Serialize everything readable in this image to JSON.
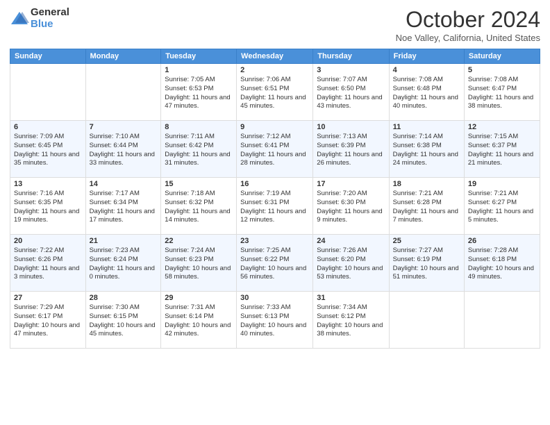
{
  "logo": {
    "general": "General",
    "blue": "Blue"
  },
  "title": "October 2024",
  "location": "Noe Valley, California, United States",
  "days_of_week": [
    "Sunday",
    "Monday",
    "Tuesday",
    "Wednesday",
    "Thursday",
    "Friday",
    "Saturday"
  ],
  "weeks": [
    [
      {
        "day": "",
        "info": ""
      },
      {
        "day": "",
        "info": ""
      },
      {
        "day": "1",
        "info": "Sunrise: 7:05 AM\nSunset: 6:53 PM\nDaylight: 11 hours and 47 minutes."
      },
      {
        "day": "2",
        "info": "Sunrise: 7:06 AM\nSunset: 6:51 PM\nDaylight: 11 hours and 45 minutes."
      },
      {
        "day": "3",
        "info": "Sunrise: 7:07 AM\nSunset: 6:50 PM\nDaylight: 11 hours and 43 minutes."
      },
      {
        "day": "4",
        "info": "Sunrise: 7:08 AM\nSunset: 6:48 PM\nDaylight: 11 hours and 40 minutes."
      },
      {
        "day": "5",
        "info": "Sunrise: 7:08 AM\nSunset: 6:47 PM\nDaylight: 11 hours and 38 minutes."
      }
    ],
    [
      {
        "day": "6",
        "info": "Sunrise: 7:09 AM\nSunset: 6:45 PM\nDaylight: 11 hours and 35 minutes."
      },
      {
        "day": "7",
        "info": "Sunrise: 7:10 AM\nSunset: 6:44 PM\nDaylight: 11 hours and 33 minutes."
      },
      {
        "day": "8",
        "info": "Sunrise: 7:11 AM\nSunset: 6:42 PM\nDaylight: 11 hours and 31 minutes."
      },
      {
        "day": "9",
        "info": "Sunrise: 7:12 AM\nSunset: 6:41 PM\nDaylight: 11 hours and 28 minutes."
      },
      {
        "day": "10",
        "info": "Sunrise: 7:13 AM\nSunset: 6:39 PM\nDaylight: 11 hours and 26 minutes."
      },
      {
        "day": "11",
        "info": "Sunrise: 7:14 AM\nSunset: 6:38 PM\nDaylight: 11 hours and 24 minutes."
      },
      {
        "day": "12",
        "info": "Sunrise: 7:15 AM\nSunset: 6:37 PM\nDaylight: 11 hours and 21 minutes."
      }
    ],
    [
      {
        "day": "13",
        "info": "Sunrise: 7:16 AM\nSunset: 6:35 PM\nDaylight: 11 hours and 19 minutes."
      },
      {
        "day": "14",
        "info": "Sunrise: 7:17 AM\nSunset: 6:34 PM\nDaylight: 11 hours and 17 minutes."
      },
      {
        "day": "15",
        "info": "Sunrise: 7:18 AM\nSunset: 6:32 PM\nDaylight: 11 hours and 14 minutes."
      },
      {
        "day": "16",
        "info": "Sunrise: 7:19 AM\nSunset: 6:31 PM\nDaylight: 11 hours and 12 minutes."
      },
      {
        "day": "17",
        "info": "Sunrise: 7:20 AM\nSunset: 6:30 PM\nDaylight: 11 hours and 9 minutes."
      },
      {
        "day": "18",
        "info": "Sunrise: 7:21 AM\nSunset: 6:28 PM\nDaylight: 11 hours and 7 minutes."
      },
      {
        "day": "19",
        "info": "Sunrise: 7:21 AM\nSunset: 6:27 PM\nDaylight: 11 hours and 5 minutes."
      }
    ],
    [
      {
        "day": "20",
        "info": "Sunrise: 7:22 AM\nSunset: 6:26 PM\nDaylight: 11 hours and 3 minutes."
      },
      {
        "day": "21",
        "info": "Sunrise: 7:23 AM\nSunset: 6:24 PM\nDaylight: 11 hours and 0 minutes."
      },
      {
        "day": "22",
        "info": "Sunrise: 7:24 AM\nSunset: 6:23 PM\nDaylight: 10 hours and 58 minutes."
      },
      {
        "day": "23",
        "info": "Sunrise: 7:25 AM\nSunset: 6:22 PM\nDaylight: 10 hours and 56 minutes."
      },
      {
        "day": "24",
        "info": "Sunrise: 7:26 AM\nSunset: 6:20 PM\nDaylight: 10 hours and 53 minutes."
      },
      {
        "day": "25",
        "info": "Sunrise: 7:27 AM\nSunset: 6:19 PM\nDaylight: 10 hours and 51 minutes."
      },
      {
        "day": "26",
        "info": "Sunrise: 7:28 AM\nSunset: 6:18 PM\nDaylight: 10 hours and 49 minutes."
      }
    ],
    [
      {
        "day": "27",
        "info": "Sunrise: 7:29 AM\nSunset: 6:17 PM\nDaylight: 10 hours and 47 minutes."
      },
      {
        "day": "28",
        "info": "Sunrise: 7:30 AM\nSunset: 6:15 PM\nDaylight: 10 hours and 45 minutes."
      },
      {
        "day": "29",
        "info": "Sunrise: 7:31 AM\nSunset: 6:14 PM\nDaylight: 10 hours and 42 minutes."
      },
      {
        "day": "30",
        "info": "Sunrise: 7:33 AM\nSunset: 6:13 PM\nDaylight: 10 hours and 40 minutes."
      },
      {
        "day": "31",
        "info": "Sunrise: 7:34 AM\nSunset: 6:12 PM\nDaylight: 10 hours and 38 minutes."
      },
      {
        "day": "",
        "info": ""
      },
      {
        "day": "",
        "info": ""
      }
    ]
  ]
}
